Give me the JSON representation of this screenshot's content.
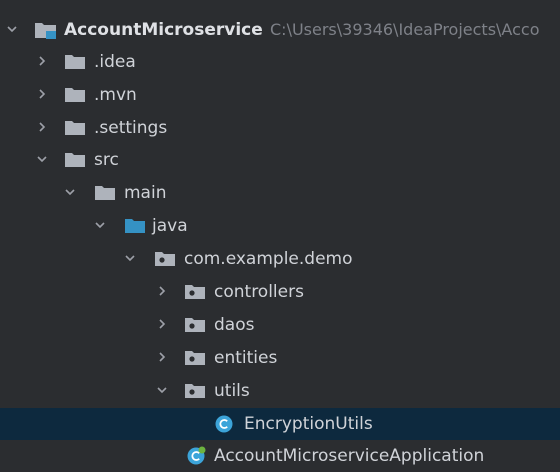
{
  "project_tree": {
    "root": {
      "label": "AccountMicroservice",
      "path": "C:\\Users\\39346\\IdeaProjects\\Acco"
    },
    "nodes": [
      {
        "label": ".idea",
        "expanded": false,
        "icon": "folder-icon"
      },
      {
        "label": ".mvn",
        "expanded": false,
        "icon": "folder-icon"
      },
      {
        "label": ".settings",
        "expanded": false,
        "icon": "folder-icon"
      },
      {
        "label": "src",
        "expanded": true,
        "icon": "folder-icon"
      },
      {
        "label": "main",
        "expanded": true,
        "icon": "folder-icon"
      },
      {
        "label": "java",
        "expanded": true,
        "icon": "source-folder-icon"
      },
      {
        "label": "com.example.demo",
        "expanded": true,
        "icon": "package-icon"
      },
      {
        "label": "controllers",
        "expanded": false,
        "icon": "package-icon"
      },
      {
        "label": "daos",
        "expanded": false,
        "icon": "package-icon"
      },
      {
        "label": "entities",
        "expanded": false,
        "icon": "package-icon"
      },
      {
        "label": "utils",
        "expanded": true,
        "icon": "package-icon"
      },
      {
        "label": "EncryptionUtils",
        "selected": true,
        "icon": "class-icon"
      },
      {
        "label": "AccountMicroserviceApplication",
        "icon": "spring-boot-class-icon"
      }
    ]
  },
  "colors": {
    "background": "#2b2d30",
    "selection": "#0d293e",
    "folder": "#aeb3bb",
    "source_folder": "#3592c4",
    "class_icon": "#3ca4d9",
    "text": "#d0d3d8",
    "path_text": "#7e8188"
  }
}
